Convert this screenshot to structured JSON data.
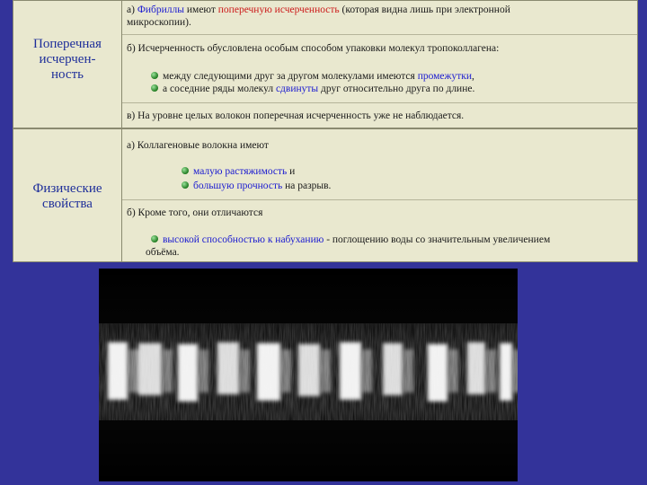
{
  "row1": {
    "heading": [
      "Поперечная",
      "исчерчен-",
      "ность"
    ],
    "a_prefix": "а) ",
    "a_term1": "Фибриллы",
    "a_mid": " имеют ",
    "a_term2": "поперечную исчерченность",
    "a_rest": " (которая видна лишь при электронной",
    "a_line2": "микроскопии).",
    "b_line": "б) Исчерченность обусловлена особым способом упаковки молекул тропоколлагена:",
    "b_item1_text": "между следующими друг за другом молекулами имеются ",
    "b_item1_term": "промежутки",
    "b_item1_end": ",",
    "b_item2_text": "а соседние ряды молекул ",
    "b_item2_term": "сдвинуты",
    "b_item2_end": " друг относительно друга по длине.",
    "c_line": "в) На уровне целых волокон поперечная исчерченность уже не наблюдается."
  },
  "row2": {
    "heading": [
      "Физические",
      "свойства"
    ],
    "a_line": "а) Коллагеновые волокна имеют",
    "a_item1_term": "малую растяжимость",
    "a_item1_end": " и",
    "a_item2_term": "большую прочность",
    "a_item2_end": " на разрыв.",
    "b_line": "б) Кроме того, они отличаются",
    "b_item_term": "высокой способностью к набуханию",
    "b_item_end": " - поглощению воды со значительным увеличением",
    "b_item_line2": "объёма."
  },
  "colors": {
    "background": "#33339a",
    "table": "#e9e8cf",
    "heading": "#1f2f9a",
    "term": "#1a1ad0",
    "highlight": "#cc1a1a",
    "bullet": "#2e8b2e"
  },
  "micrograph": {
    "icon": "electron-micrograph-collagen-fibril"
  }
}
